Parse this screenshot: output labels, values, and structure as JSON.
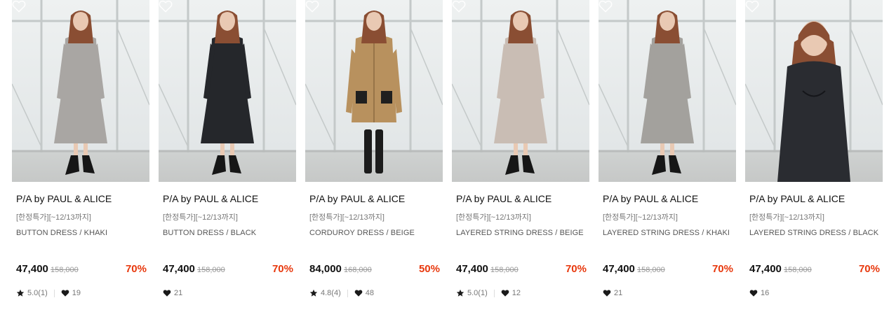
{
  "products": [
    {
      "brand": "P/A by PAUL & ALICE",
      "promo": "[한정특가][~12/13까지]",
      "name": "BUTTON DRESS / KHAKI",
      "price": "47,400",
      "original_price": "158,000",
      "discount": "70%",
      "rating": "5.0(1)",
      "likes": "19",
      "garment_color": "#a9a6a3",
      "garment": "dress"
    },
    {
      "brand": "P/A by PAUL & ALICE",
      "promo": "[한정특가][~12/13까지]",
      "name": "BUTTON DRESS / BLACK",
      "price": "47,400",
      "original_price": "158,000",
      "discount": "70%",
      "rating": "",
      "likes": "21",
      "garment_color": "#25272b",
      "garment": "dress"
    },
    {
      "brand": "P/A by PAUL & ALICE",
      "promo": "[한정특가][~12/13까지]",
      "name": "CORDUROY DRESS / BEIGE",
      "price": "84,000",
      "original_price": "168,000",
      "discount": "50%",
      "rating": "4.8(4)",
      "likes": "48",
      "garment_color": "#b8915e",
      "garment": "coat"
    },
    {
      "brand": "P/A by PAUL & ALICE",
      "promo": "[한정특가][~12/13까지]",
      "name": "LAYERED STRING DRESS / BEIGE",
      "price": "47,400",
      "original_price": "158,000",
      "discount": "70%",
      "rating": "5.0(1)",
      "likes": "12",
      "garment_color": "#c9bdb4",
      "garment": "dress"
    },
    {
      "brand": "P/A by PAUL & ALICE",
      "promo": "[한정특가][~12/13까지]",
      "name": "LAYERED STRING DRESS / KHAKI",
      "price": "47,400",
      "original_price": "158,000",
      "discount": "70%",
      "rating": "",
      "likes": "21",
      "garment_color": "#a3a19d",
      "garment": "dress"
    },
    {
      "brand": "P/A by PAUL & ALICE",
      "promo": "[한정특가][~12/13까지]",
      "name": "LAYERED STRING DRESS / BLACK",
      "price": "47,400",
      "original_price": "158,000",
      "discount": "70%",
      "rating": "",
      "likes": "16",
      "garment_color": "#2a2c31",
      "garment": "closeup"
    }
  ],
  "icons": {
    "wishlist": "heart-outline-icon",
    "rating": "star-icon",
    "likes": "heart-filled-icon"
  },
  "colors": {
    "discount": "#e8380d",
    "price": "#111111",
    "muted": "#777777"
  }
}
